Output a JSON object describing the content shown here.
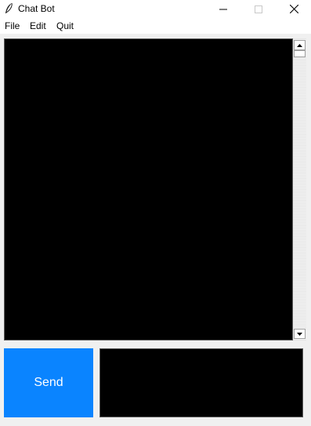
{
  "window": {
    "title": "Chat Bot"
  },
  "menu": {
    "file": "File",
    "edit": "Edit",
    "quit": "Quit"
  },
  "chat": {
    "messages": []
  },
  "input": {
    "value": ""
  },
  "send_button": {
    "label": "Send"
  },
  "colors": {
    "send_button_bg": "#0a84ff",
    "chat_bg": "#000000",
    "input_bg": "#000000",
    "window_bg": "#f0f0f0"
  },
  "icons": {
    "app": "feather-icon",
    "minimize": "minimize-icon",
    "maximize": "maximize-icon",
    "close": "close-icon",
    "scroll_up": "arrow-up-icon",
    "scroll_down": "arrow-down-icon"
  }
}
